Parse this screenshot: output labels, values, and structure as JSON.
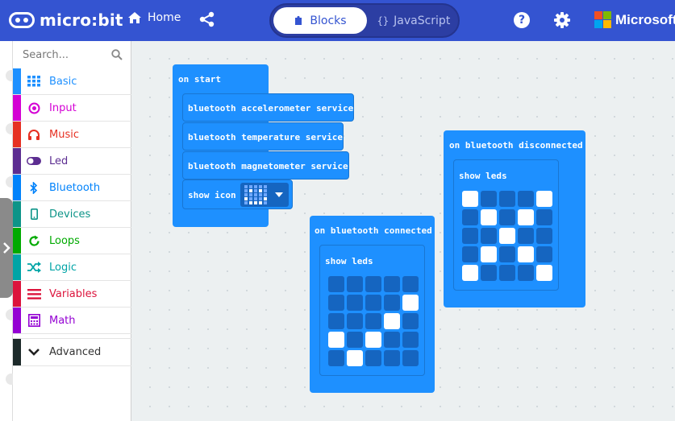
{
  "app": {
    "logo_text": "micro:bit",
    "home_label": "Home",
    "blocks_label": "Blocks",
    "javascript_label": "JavaScript",
    "help_label": "?",
    "brand_label": "Microsoft",
    "accent_color": "#3454d1"
  },
  "toolbox": {
    "search_placeholder": "Search...",
    "categories": [
      {
        "label": "Basic",
        "color": "#1e90ff",
        "icon": "grid-icon"
      },
      {
        "label": "Input",
        "color": "#d400d4",
        "icon": "radio-target-icon"
      },
      {
        "label": "Music",
        "color": "#e63022",
        "icon": "headphones-icon"
      },
      {
        "label": "Led",
        "color": "#5c2d91",
        "icon": "toggle-icon"
      },
      {
        "label": "Bluetooth",
        "color": "#0082fb",
        "icon": "bluetooth-icon"
      },
      {
        "label": "Devices",
        "color": "#0d9488",
        "icon": "phone-icon"
      },
      {
        "label": "Loops",
        "color": "#00aa00",
        "icon": "refresh-icon"
      },
      {
        "label": "Logic",
        "color": "#00a4a6",
        "icon": "shuffle-icon"
      },
      {
        "label": "Variables",
        "color": "#dc143c",
        "icon": "lines-icon"
      },
      {
        "label": "Math",
        "color": "#9400d3",
        "icon": "calculator-icon"
      }
    ],
    "advanced_label": "Advanced"
  },
  "workspace": {
    "on_start": {
      "label": "on start",
      "statements": [
        "bluetooth accelerometer service",
        "bluetooth temperature service",
        "bluetooth magnetometer service"
      ],
      "show_icon_label": "show icon"
    },
    "on_connected": {
      "label": "on bluetooth connected",
      "show_leds_label": "show leds",
      "leds": [
        [
          0,
          0,
          0,
          0,
          0
        ],
        [
          0,
          0,
          0,
          0,
          1
        ],
        [
          0,
          0,
          0,
          1,
          0
        ],
        [
          1,
          0,
          1,
          0,
          0
        ],
        [
          0,
          1,
          0,
          0,
          0
        ]
      ]
    },
    "on_disconnected": {
      "label": "on bluetooth disconnected",
      "show_leds_label": "show leds",
      "leds": [
        [
          1,
          0,
          0,
          0,
          1
        ],
        [
          0,
          1,
          0,
          1,
          0
        ],
        [
          0,
          0,
          1,
          0,
          0
        ],
        [
          0,
          1,
          0,
          1,
          0
        ],
        [
          1,
          0,
          0,
          0,
          1
        ]
      ]
    }
  }
}
